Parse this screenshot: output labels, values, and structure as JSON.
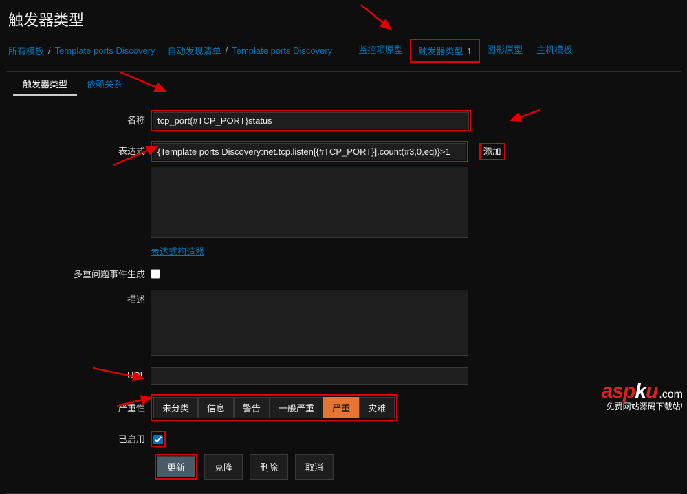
{
  "page_title": "触发器类型",
  "breadcrumb": {
    "all_templates": "所有模板",
    "tpl1": "Template ports Discovery",
    "auto_discovery_list": "自动发现清单",
    "tpl2": "Template ports Discovery"
  },
  "tabs": {
    "monitor_proto": "监控项原型",
    "trigger_proto": "触发器类型",
    "trigger_count": "1",
    "graph_proto": "图形原型",
    "host_template": "主机模板"
  },
  "subtabs": {
    "trigger_type": "触发器类型",
    "dependency": "依赖关系"
  },
  "form": {
    "name_label": "名称",
    "name_value": "tcp_port{#TCP_PORT}status",
    "expr_label": "表达式",
    "expr_value": "{Template ports Discovery:net.tcp.listen[{#TCP_PORT}].count(#3,0,eq)}>1",
    "expr_builder": "表达式构造器",
    "add_link": "添加",
    "multi_problem_label": "多重问题事件生成",
    "desc_label": "描述",
    "url_label": "URL",
    "url_value": "",
    "severity_label": "严重性",
    "enabled_label": "已启用"
  },
  "severity": {
    "unclassified": "未分类",
    "info": "信息",
    "warning": "警告",
    "average": "一般严重",
    "high": "严重",
    "disaster": "灾难"
  },
  "buttons": {
    "update": "更新",
    "clone": "克隆",
    "delete": "删除",
    "cancel": "取消"
  },
  "watermark": {
    "brand_asp": "asp",
    "brand_k": "k",
    "brand_u": "u",
    "domain": ".com",
    "sub": "免费网站源码下载站!"
  }
}
